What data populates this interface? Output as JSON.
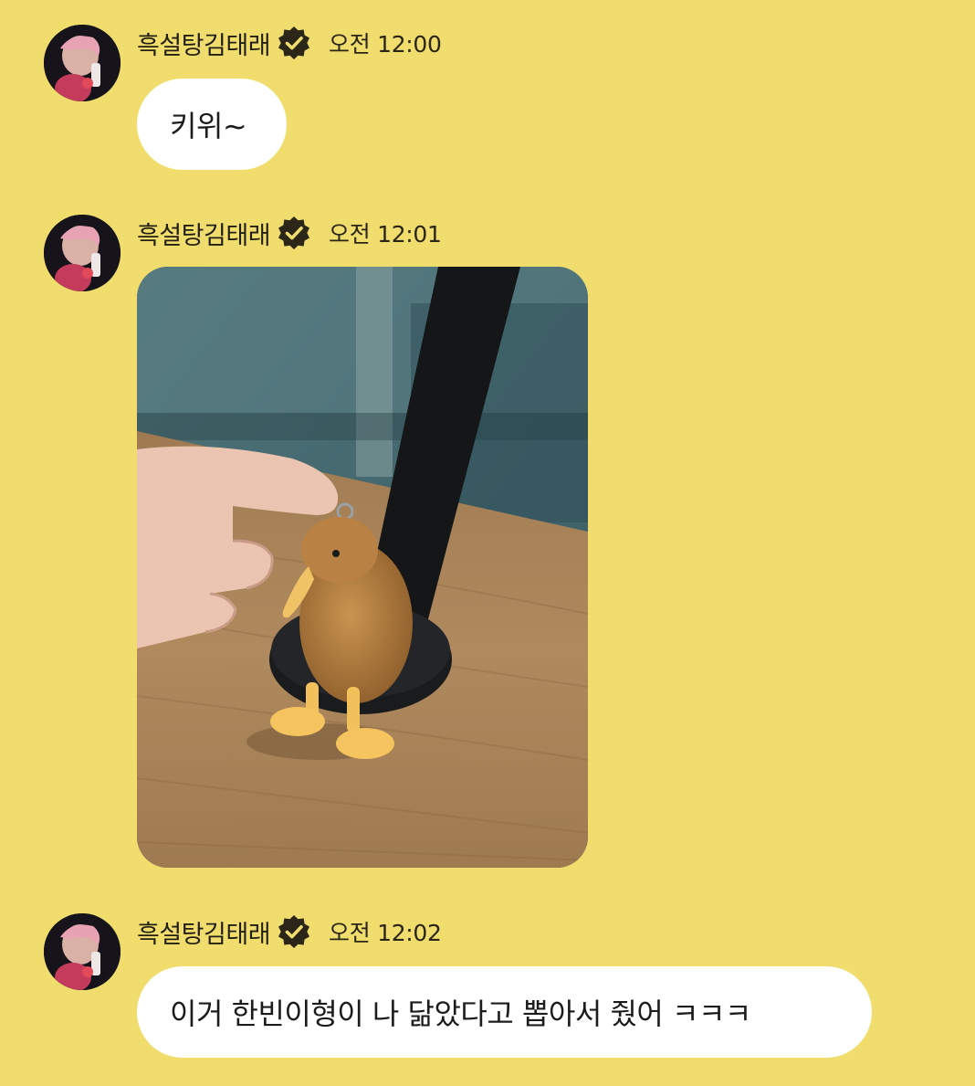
{
  "messages": [
    {
      "sender": "흑설탕김태래",
      "time": "오전 12:00",
      "type": "text",
      "text": "키위~"
    },
    {
      "sender": "흑설탕김태래",
      "time": "오전 12:01",
      "type": "image",
      "image_icon": "kiwi-bird-plush-keychain-photo"
    },
    {
      "sender": "흑설탕김태래",
      "time": "오전 12:02",
      "type": "text",
      "text": "이거 한빈이형이 나 닮았다고 뽑아서 줬어 ㅋㅋㅋ"
    }
  ],
  "colors": {
    "background": "#f0dd6e",
    "bubble": "#ffffff",
    "verified_badge": "#2b2618"
  },
  "icons": {
    "verified": "verified-badge-icon",
    "avatar": "profile-avatar"
  }
}
